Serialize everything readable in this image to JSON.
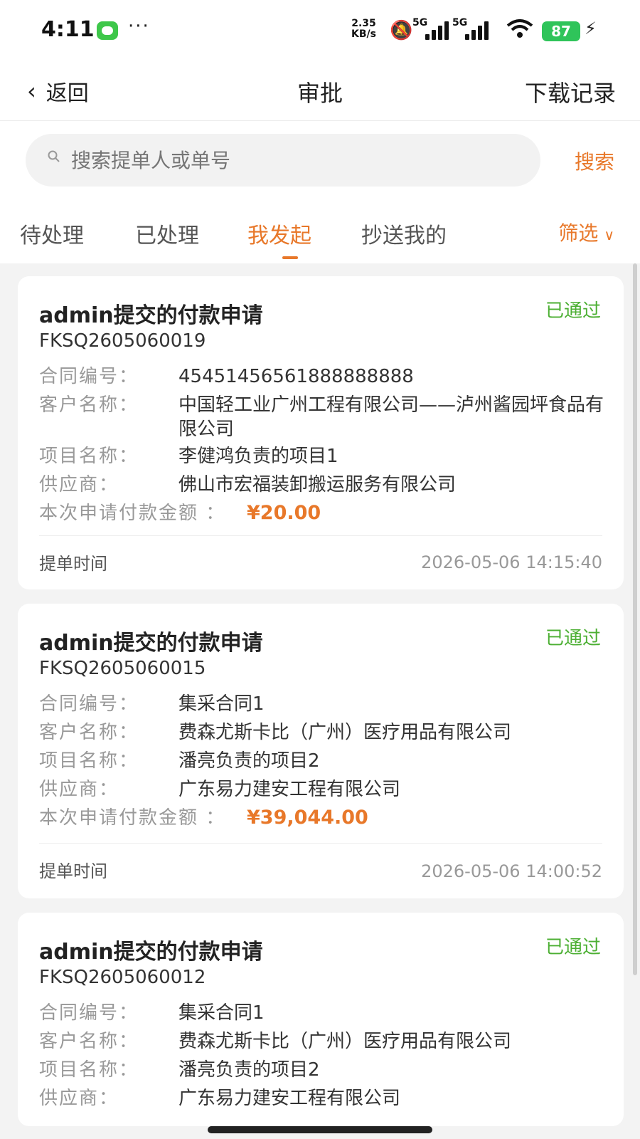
{
  "status_bar": {
    "time": "4:11",
    "more": "···",
    "net_speed_top": "2.35",
    "net_speed_bottom": "KB/s",
    "net1": "5G",
    "net2": "5G",
    "battery": "87"
  },
  "nav": {
    "back_label": "返回",
    "title": "审批",
    "right_label": "下载记录"
  },
  "search": {
    "placeholder": "搜索提单人或单号",
    "button_label": "搜索"
  },
  "tabs": {
    "items": [
      "待处理",
      "已处理",
      "我发起",
      "抄送我的"
    ],
    "active": "我发起",
    "filter_label": "筛选"
  },
  "labels": {
    "contract_no": "合同编号：",
    "customer": "客户名称：",
    "project": "项目名称：",
    "supplier": "供应商：",
    "amount": "本次申请付款金额 ：",
    "submit_time": "提单时间"
  },
  "cards": [
    {
      "title": "admin提交的付款申请",
      "status": "已通过",
      "number": "FKSQ2605060019",
      "contract_no": "45451456561888888888",
      "customer": "中国轻工业广州工程有限公司——泸州酱园坪食品有限公司",
      "project": "李健鸿负责的项目1",
      "supplier": "佛山市宏福装卸搬运服务有限公司",
      "amount": "¥20.00",
      "submit_time": "2026-05-06 14:15:40"
    },
    {
      "title": "admin提交的付款申请",
      "status": "已通过",
      "number": "FKSQ2605060015",
      "contract_no": "集采合同1",
      "customer": "费森尤斯卡比（广州）医疗用品有限公司",
      "project": "潘亮负责的项目2",
      "supplier": "广东易力建安工程有限公司",
      "amount": "¥39,044.00",
      "submit_time": "2026-05-06 14:00:52"
    },
    {
      "title": "admin提交的付款申请",
      "status": "已通过",
      "number": "FKSQ2605060012",
      "contract_no": "集采合同1",
      "customer": "费森尤斯卡比（广州）医疗用品有限公司",
      "project": "潘亮负责的项目2",
      "supplier": "广东易力建安工程有限公司"
    }
  ],
  "colors": {
    "accent": "#e8782a",
    "status_approved": "#4caf33",
    "battery": "#2fc45a"
  }
}
